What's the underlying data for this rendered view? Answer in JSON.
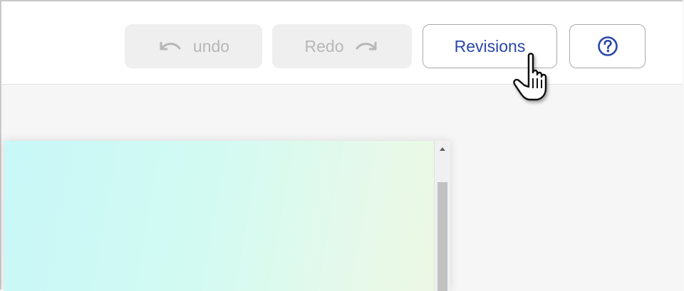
{
  "toolbar": {
    "undo_label": "undo",
    "redo_label": "Redo",
    "revisions_label": "Revisions",
    "undo_icon": "undo-arrow-icon",
    "redo_icon": "redo-arrow-icon",
    "help_icon": "question-circle-icon"
  },
  "cursor": {
    "icon": "hand-pointer-icon"
  },
  "colors": {
    "accent_text": "#2a47a8",
    "disabled_bg": "#efefef",
    "disabled_text": "#b7b7b7",
    "canvas_gradient_start": "#c8f8f8",
    "canvas_gradient_end": "#eef8e2"
  }
}
